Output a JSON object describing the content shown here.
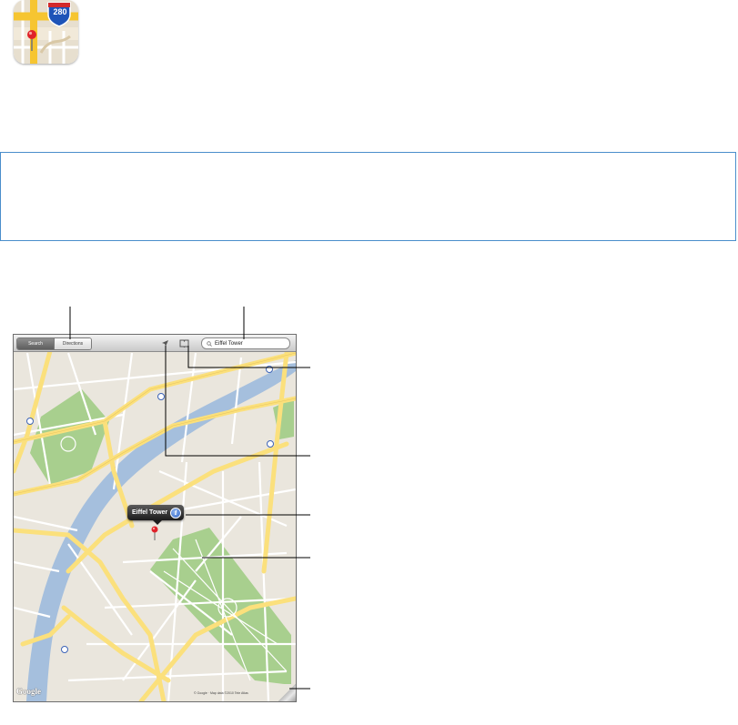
{
  "app_icon": {
    "name": "maps-app-icon",
    "highway_shield": "280"
  },
  "map_screen": {
    "toolbar": {
      "segments": [
        {
          "label": "Search",
          "selected": true
        },
        {
          "label": "Directions",
          "selected": false
        }
      ],
      "current_location_icon": "location-arrow-icon",
      "bookmarks_icon": "bookmarks-book-icon",
      "search_value": "Eiffel Tower",
      "search_icon": "magnifier-icon"
    },
    "pin_callout": {
      "title": "Eiffel Tower",
      "info_icon": "info-button-icon"
    },
    "watermark": "Google",
    "copyright": "© Google · Map data ©2010 Tele Atlas"
  },
  "colors": {
    "accent_border": "#4a8ecb",
    "map_land": "#eae6dd",
    "map_park": "#a8cf8e",
    "map_river": "#a5bfdd",
    "map_major_road": "#fbe07c",
    "pin_head": "#e0222a"
  }
}
